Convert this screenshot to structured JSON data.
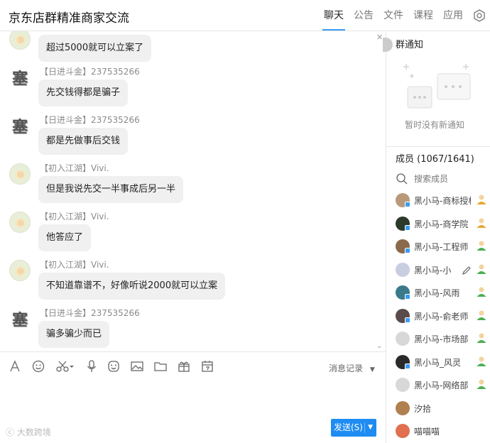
{
  "header": {
    "title": "京东店群精准商家交流",
    "tabs": [
      {
        "label": "聊天",
        "active": true
      },
      {
        "label": "公告",
        "active": false
      },
      {
        "label": "文件",
        "active": false
      },
      {
        "label": "课程",
        "active": false
      },
      {
        "label": "应用",
        "active": false
      }
    ],
    "settings_icon": "gear-icon"
  },
  "messages": [
    {
      "sender": "",
      "text": "超过5000就可以立案了",
      "avatar": "flower"
    },
    {
      "sender": "【日进斗金】237535266",
      "text": "先交钱得都是骗子",
      "avatar": "text",
      "avatar_char": "塞"
    },
    {
      "sender": "【日进斗金】237535266",
      "text": "都是先做事后交钱",
      "avatar": "text",
      "avatar_char": "塞"
    },
    {
      "sender": "【初入江湖】Vivi.",
      "text": "但是我说先交一半事成后另一半",
      "avatar": "flower"
    },
    {
      "sender": "【初入江湖】Vivi.",
      "text": "他答应了",
      "avatar": "flower"
    },
    {
      "sender": "【初入江湖】Vivi.",
      "text": "不知道靠谱不，好像听说2000就可以立案",
      "avatar": "flower"
    },
    {
      "sender": "【日进斗金】237535266",
      "text": "骗多骗少而已",
      "avatar": "text",
      "avatar_char": "塞"
    }
  ],
  "toolbar": {
    "icons": [
      "font-icon",
      "emoji-icon",
      "scissors-icon",
      "microphone-icon",
      "sticker-icon",
      "image-icon",
      "folder-icon",
      "gift-icon",
      "calendar-icon"
    ],
    "history_label": "消息记录",
    "send_label": "发送(S)"
  },
  "watermark": "大数跨境",
  "notice": {
    "title": "群通知",
    "empty_text": "暂时没有新通知"
  },
  "members": {
    "title": "成员 (1067/1641)",
    "search_placeholder": "搜索成员",
    "list": [
      {
        "name": "黑小马-商标授权",
        "avatar_color": "#b89a7a",
        "role_color": "#e8a530"
      },
      {
        "name": "黑小马-商学院",
        "avatar_color": "#2b3a2b",
        "role_color": "#e8a530"
      },
      {
        "name": "黑小马-工程师",
        "avatar_color": "#8a6a4a",
        "role_color": "#4caf50"
      },
      {
        "name": "黑小马-小",
        "avatar_color": "#c8cde0",
        "role_color": "#4caf50"
      },
      {
        "name": "黑小马-风雨",
        "avatar_color": "#3a7a8a",
        "role_color": "#4caf50"
      },
      {
        "name": "黑小马-俞老师",
        "avatar_color": "#5a4a4a",
        "role_color": "#4caf50"
      },
      {
        "name": "黑小马-市场部",
        "avatar_color": "#d8d8d8",
        "role_color": "#4caf50"
      },
      {
        "name": "黑小马_风灵",
        "avatar_color": "#2a2a2a",
        "role_color": "#4caf50"
      },
      {
        "name": "黑小马-网络部",
        "avatar_color": "#d8d8d8",
        "role_color": "#4caf50"
      },
      {
        "name": "汐拾",
        "avatar_color": "#b08050",
        "role_color": ""
      },
      {
        "name": "喵喵喵",
        "avatar_color": "#e07050",
        "role_color": ""
      }
    ]
  },
  "colors": {
    "accent": "#1e8cf2",
    "bubble": "#f0f0f0"
  }
}
